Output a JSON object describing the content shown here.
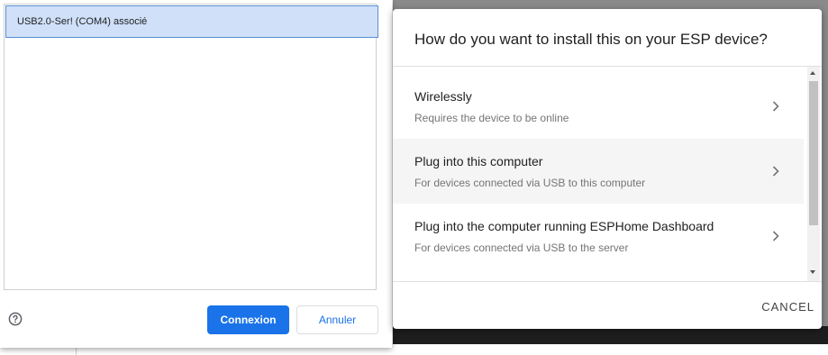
{
  "port_chooser": {
    "ports": [
      {
        "label": "USB2.0-Ser! (COM4) associé",
        "selected": true
      }
    ],
    "connect_label": "Connexion",
    "cancel_label": "Annuler",
    "help_icon": "help-circle-icon",
    "accent_color": "#1a73e8"
  },
  "install_dialog": {
    "title": "How do you want to install this on your ESP device?",
    "options": [
      {
        "label": "Wirelessly",
        "description": "Requires the device to be online"
      },
      {
        "label": "Plug into this computer",
        "description": "For devices connected via USB to this computer"
      },
      {
        "label": "Plug into the computer running ESPHome Dashboard",
        "description": "For devices connected via USB to the server"
      }
    ],
    "cancel_label": "CANCEL",
    "option_icon": "chevron-right-icon"
  }
}
